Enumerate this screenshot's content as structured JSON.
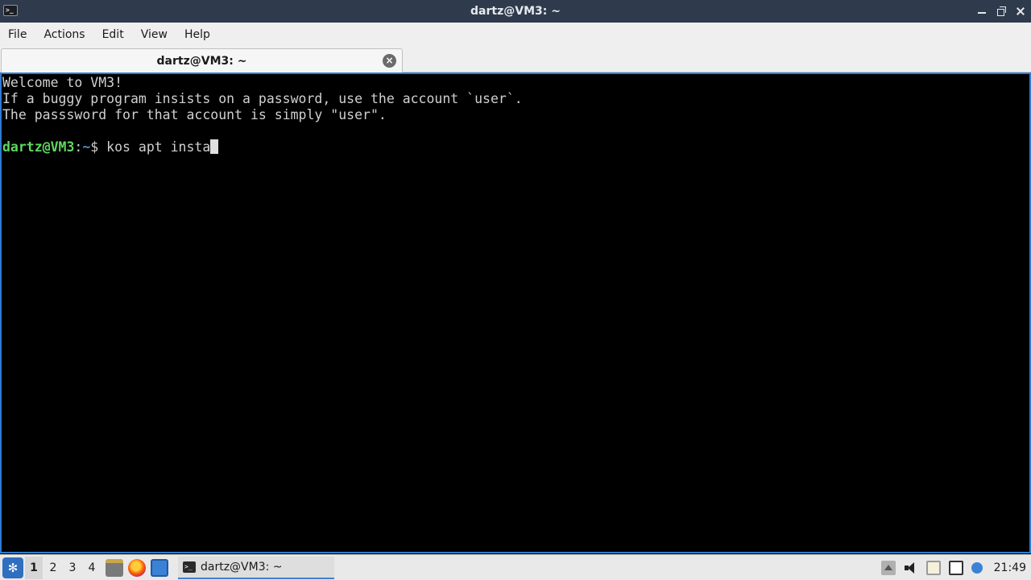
{
  "window": {
    "title": "dartz@VM3: ~",
    "app_icon": "terminal-icon"
  },
  "menu": {
    "items": [
      "File",
      "Actions",
      "Edit",
      "View",
      "Help"
    ]
  },
  "tabs": [
    {
      "label": "dartz@VM3: ~",
      "close_icon": "close-circle-icon"
    }
  ],
  "terminal": {
    "lines": [
      "Welcome to VM3!",
      "If a buggy program insists on a password, use the account `user`.",
      "The passsword for that account is simply \"user\".",
      ""
    ],
    "prompt": {
      "user_host": "dartz@VM3",
      "separator": ":",
      "path": "~",
      "symbol": "$",
      "command": " kos apt insta"
    },
    "colors": {
      "user_host": "#5fd75f",
      "path": "#4d8fd8",
      "text": "#d0d0d0",
      "background": "#000000"
    }
  },
  "taskbar": {
    "desktops": [
      "1",
      "2",
      "3",
      "4"
    ],
    "active_desktop": "1",
    "quick_launch": [
      "files-icon",
      "firefox-icon",
      "desktop-icon"
    ],
    "tasks": [
      {
        "label": "dartz@VM3: ~",
        "icon": "terminal-icon"
      }
    ],
    "tray_icons": [
      "up-arrow-icon",
      "volume-icon",
      "clipboard-icon",
      "network-icon",
      "update-icon"
    ],
    "clock": "21:49"
  }
}
